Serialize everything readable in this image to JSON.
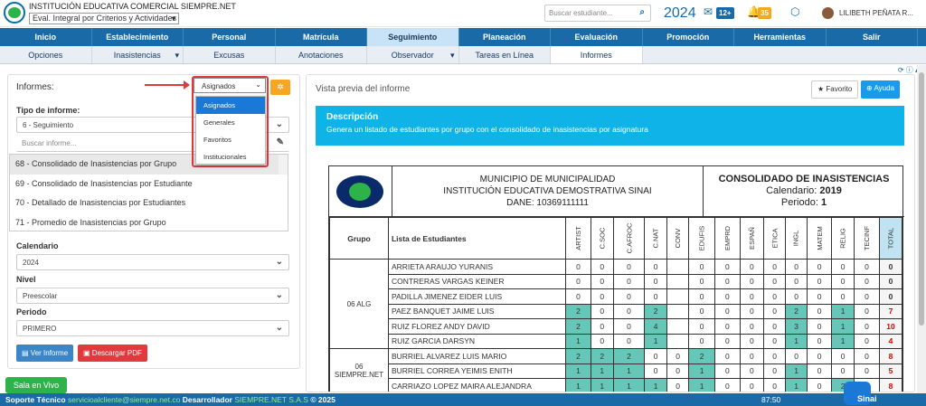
{
  "header": {
    "school": "INSTITUCIÓN EDUCATIVA COMERCIAL SIEMPRE.NET",
    "module": "Eval. Integral por Criterios y Actividades",
    "search_placeholder": "Buscar estudiante...",
    "year": "2024",
    "msg_badge": "12+",
    "notif_badge": "35",
    "user": "LILIBETH PEÑATA R..."
  },
  "menu": [
    "Inicio",
    "Establecimiento",
    "Personal",
    "Matrícula",
    "Seguimiento",
    "Planeación",
    "Evaluación",
    "Promoción",
    "Herramientas",
    "Salir"
  ],
  "submenu": [
    "Opciones",
    "Inasistencias",
    "Excusas",
    "Anotaciones",
    "Observador",
    "Tareas en Línea",
    "Informes"
  ],
  "left": {
    "informes_label": "Informes:",
    "dropdown_value": "Asignados",
    "dropdown_options": [
      "Asignados",
      "Generales",
      "Favoritos",
      "Institucionales"
    ],
    "tipo_label": "Tipo de informe:",
    "tipo_value": "6 - Seguimiento",
    "search_placeholder": "Buscar informe...",
    "reports": [
      "68 - Consolidado de Inasistencias por Grupo",
      "69 - Consolidado de Inasistencias por Estudiante",
      "70 - Detallado de Inasistencias por Estudiantes",
      "71 - Promedio de Inasistencias por Grupo"
    ],
    "calendario_label": "Calendario",
    "calendario_value": "2024",
    "nivel_label": "Nivel",
    "nivel_value": "Preescolar",
    "periodo_label": "Periodo",
    "periodo_value": "PRIMERO",
    "ver_btn": "Ver Informe",
    "pdf_btn": "Descargar PDF",
    "sala_btn": "Sala en Vivo"
  },
  "right": {
    "title": "Vista previa del informe",
    "fav_btn": "Favorito",
    "help_btn": "Ayuda",
    "desc_title": "Descripción",
    "desc_text": "Genera un listado de estudiantes por grupo con el consolidado de inasistencias por asignatura"
  },
  "report": {
    "mun": "MUNICIPIO DE MUNICIPALIDAD",
    "inst": "INSTITUCIÓN EDUCATIVA DEMOSTRATIVA SINAI",
    "dane": "DANE: 10369111111",
    "title": "CONSOLIDADO DE INASISTENCIAS",
    "cal_label": "Calendario:",
    "cal": "2019",
    "per_label": "Periodo:",
    "per": "1",
    "col_grupo": "Grupo",
    "col_lista": "Lista de Estudiantes",
    "subjects": [
      "ARTIST",
      "C.SOC",
      "C.AFROC",
      "C.NAT",
      "CONV",
      "EDUFIS",
      "EMPRD",
      "ESPAÑ",
      "ETICA",
      "INGL",
      "MATEM",
      "RELIG",
      "TECINF",
      "TOTAL"
    ],
    "groups": [
      {
        "name": "06 ALG",
        "rows": [
          {
            "n": "ARRIETA ARAUJO YURANIS",
            "v": [
              "0",
              "0",
              "0",
              "0",
              "",
              "0",
              "0",
              "0",
              "0",
              "0",
              "0",
              "0",
              "0",
              "0"
            ]
          },
          {
            "n": "CONTRERAS VARGAS KEINER",
            "v": [
              "0",
              "0",
              "0",
              "0",
              "",
              "0",
              "0",
              "0",
              "0",
              "0",
              "0",
              "0",
              "0",
              "0"
            ]
          },
          {
            "n": "PADILLA JIMENEZ EIDER LUIS",
            "v": [
              "0",
              "0",
              "0",
              "0",
              "",
              "0",
              "0",
              "0",
              "0",
              "0",
              "0",
              "0",
              "0",
              "0"
            ]
          },
          {
            "n": "PAEZ BANQUET JAIME LUIS",
            "v": [
              "2",
              "0",
              "0",
              "2",
              "",
              "0",
              "0",
              "0",
              "0",
              "2",
              "0",
              "1",
              "0",
              "7"
            ]
          },
          {
            "n": "RUIZ FLOREZ ANDY DAVID",
            "v": [
              "2",
              "0",
              "0",
              "4",
              "",
              "0",
              "0",
              "0",
              "0",
              "3",
              "0",
              "1",
              "0",
              "10"
            ]
          },
          {
            "n": "RUIZ GARCIA DARSYN",
            "v": [
              "1",
              "0",
              "0",
              "1",
              "",
              "0",
              "0",
              "0",
              "0",
              "1",
              "0",
              "1",
              "0",
              "4"
            ]
          }
        ]
      },
      {
        "name": "06 SIEMPRE.NET",
        "rows": [
          {
            "n": "BURRIEL ALVAREZ LUIS MARIO",
            "v": [
              "2",
              "2",
              "2",
              "0",
              "0",
              "2",
              "0",
              "0",
              "0",
              "0",
              "0",
              "0",
              "0",
              "8"
            ]
          },
          {
            "n": "BURRIEL CORREA YEIMIS ENITH",
            "v": [
              "1",
              "1",
              "1",
              "0",
              "0",
              "1",
              "0",
              "0",
              "0",
              "1",
              "0",
              "0",
              "0",
              "5"
            ]
          },
          {
            "n": "CARRIAZO LOPEZ MAIRA ALEJANDRA",
            "v": [
              "1",
              "1",
              "1",
              "1",
              "0",
              "1",
              "0",
              "0",
              "0",
              "1",
              "0",
              "2",
              "0",
              "8"
            ]
          }
        ]
      }
    ]
  },
  "footer": {
    "soporte": "Soporte Técnico",
    "email": "servicioalcliente@siempre.net.co",
    "dev": "Desarrollador",
    "dev_name": "SIEMPRE.NET S.A.S",
    "year": "© 2025",
    "clock": "87:50",
    "sinai": "Sinai"
  }
}
